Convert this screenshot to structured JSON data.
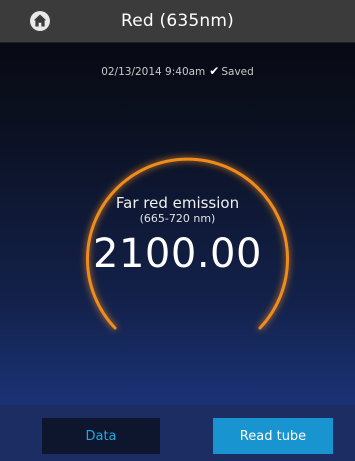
{
  "header": {
    "title": "Red (635nm)",
    "home_icon": "home-icon"
  },
  "status": {
    "timestamp": "02/13/2014 9:40am",
    "check_icon": "✔",
    "saved_label": "Saved"
  },
  "reading": {
    "label": "Far red emission",
    "range": "(665-720 nm)",
    "value": "2100.00"
  },
  "buttons": {
    "data_label": "Data",
    "read_label": "Read tube"
  },
  "colors": {
    "gauge_arc": "#f08c1e",
    "primary_button": "#1895d1",
    "secondary_button_text": "#23a8e6",
    "title_bar": "#3b3b3b"
  }
}
